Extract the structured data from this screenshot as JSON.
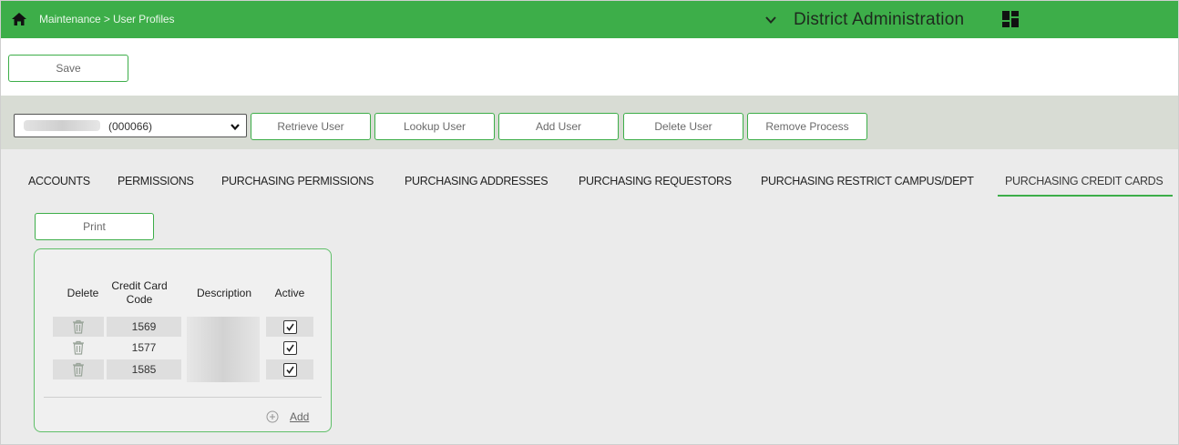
{
  "header": {
    "breadcrumb": "Maintenance > User Profiles",
    "district_name": "District Administration",
    "brand_color": "#3dae49"
  },
  "toolbar": {
    "save_label": "Save"
  },
  "user_bar": {
    "selected_user_id": "(000066)",
    "buttons": [
      "Retrieve User",
      "Lookup User",
      "Add User",
      "Delete User",
      "Remove Process"
    ]
  },
  "tabs": [
    {
      "label": "ACCOUNTS",
      "active": false
    },
    {
      "label": "PERMISSIONS",
      "active": false
    },
    {
      "label": "PURCHASING PERMISSIONS",
      "active": false
    },
    {
      "label": "PURCHASING ADDRESSES",
      "active": false
    },
    {
      "label": "PURCHASING REQUESTORS",
      "active": false
    },
    {
      "label": "PURCHASING RESTRICT CAMPUS/DEPT",
      "active": false
    },
    {
      "label": "PURCHASING CREDIT CARDS",
      "active": true
    }
  ],
  "print_label": "Print",
  "table": {
    "columns": [
      "Delete",
      "Credit Card Code",
      "Description",
      "Active"
    ],
    "rows": [
      {
        "code": "1569",
        "active": true
      },
      {
        "code": "1577",
        "active": true
      },
      {
        "code": "1585",
        "active": true
      }
    ],
    "add_label": "Add"
  },
  "icons": {
    "home": "home-icon",
    "chevron": "chevron-down-icon",
    "grid": "grid-icon",
    "trash": "trash-icon",
    "check": "check-icon",
    "add": "plus-circle-icon"
  }
}
